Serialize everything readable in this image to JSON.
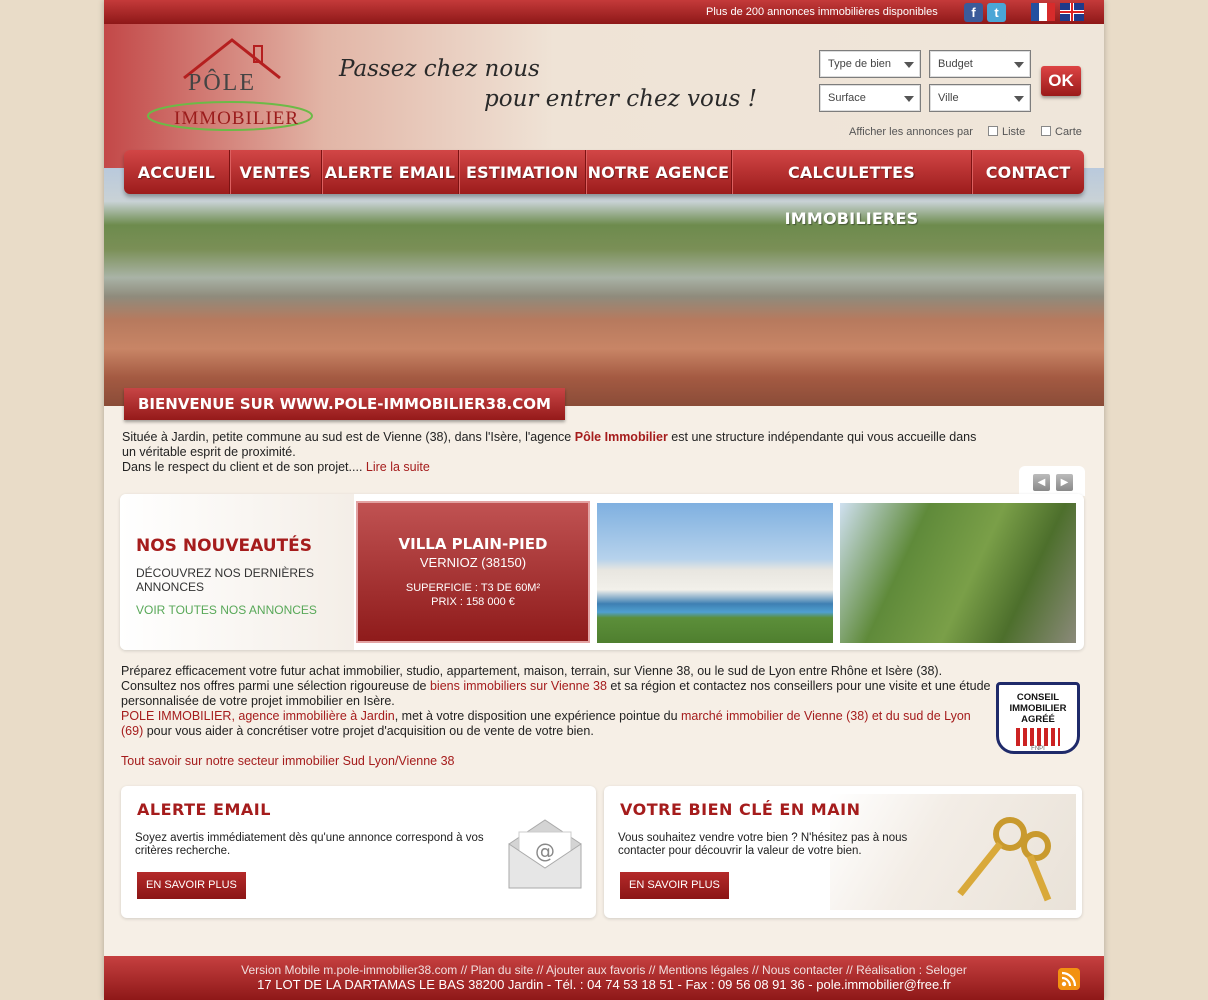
{
  "topbar": {
    "tagline": "Plus de 200 annonces immobilières disponibles",
    "facebook_icon": "f",
    "twitter_icon": "t"
  },
  "logo": {
    "line1": "PÔLE",
    "line2": "IMMOBILIER"
  },
  "slogan": {
    "line1": "Passez chez nous",
    "line2": "pour entrer chez vous !"
  },
  "search": {
    "type_de_bien": "Type de bien",
    "budget": "Budget",
    "surface": "Surface",
    "ville": "Ville",
    "ok": "OK",
    "display_label": "Afficher les annonces par",
    "liste": "Liste",
    "carte": "Carte"
  },
  "nav": [
    {
      "label": "ACCUEIL"
    },
    {
      "label": "VENTES"
    },
    {
      "label": "ALERTE EMAIL"
    },
    {
      "label": "ESTIMATION"
    },
    {
      "label": "NOTRE AGENCE"
    },
    {
      "label": "CALCULETTES IMMOBILIERES"
    },
    {
      "label": "CONTACT"
    }
  ],
  "welcome": "BIENVENUE SUR WWW.POLE-IMMOBILIER38.COM",
  "intro": {
    "p1a": "Située à Jardin, petite commune au sud est de Vienne (38), dans l'Isère, l'agence ",
    "p1b": "Pôle Immobilier",
    "p1c": " est une structure indépendante qui vous accueille dans un véritable esprit de proximité.",
    "p2": "Dans le respect du client et de son projet.... ",
    "more": "Lire la suite"
  },
  "news": {
    "title": "NOS NOUVEAUTÉS",
    "subtitle": "DÉCOUVREZ NOS DERNIÈRES ANNONCES",
    "all": "VOIR TOUTES NOS ANNONCES",
    "featured": {
      "type": "VILLA PLAIN-PIED",
      "city": "VERNIOZ (38150)",
      "surface": "SUPERFICIE : T3 DE 60M²",
      "price": "PRIX : 158 000 €"
    }
  },
  "text2": {
    "a": "Préparez efficacement votre futur achat immobilier, studio, appartement, maison, terrain, sur Vienne 38, ou le sud de Lyon entre Rhône et Isère (38). Consultez nos offres parmi une sélection rigoureuse de ",
    "b": "biens immobiliers sur Vienne 38",
    "c": " et sa région et contactez nos conseillers pour une visite et une étude personnalisée de votre projet immobilier en Isère.",
    "d": "POLE IMMOBILIER, agence immobilière à Jardin",
    "e": ", met à votre disposition une expérience pointue du ",
    "f": "marché immobilier de Vienne (38) et du sud de Lyon (69)",
    "g": " pour vous aider à concrétiser votre projet d'acquisition ou de vente de votre bien.",
    "secteur": "Tout savoir sur notre secteur immobilier Sud Lyon/Vienne 38"
  },
  "badge": {
    "text": "CONSEIL IMMOBILIER AGRÉÉ",
    "small": "FNPI"
  },
  "alerte": {
    "title": "ALERTE EMAIL",
    "desc": "Soyez avertis immédiatement dès qu'une annonce correspond à vos critères recherche.",
    "btn": "EN SAVOIR PLUS"
  },
  "bien": {
    "title": "VOTRE BIEN CLÉ EN MAIN",
    "desc": "Vous souhaitez vendre votre bien ? N'hésitez pas à nous contacter pour découvrir la valeur de votre bien.",
    "btn": "EN SAVOIR PLUS"
  },
  "footer": {
    "links": "Version Mobile m.pole-immobilier38.com  //  Plan du site  //  Ajouter aux favoris  //  Mentions légales  //  Nous contacter  //  Réalisation : Seloger",
    "address": "17 LOT DE LA DARTAMAS LE BAS 38200 Jardin - Tél. : 04 74 53 18 51 - Fax : 09 56 08 91 36 - pole.immobilier@free.fr"
  }
}
